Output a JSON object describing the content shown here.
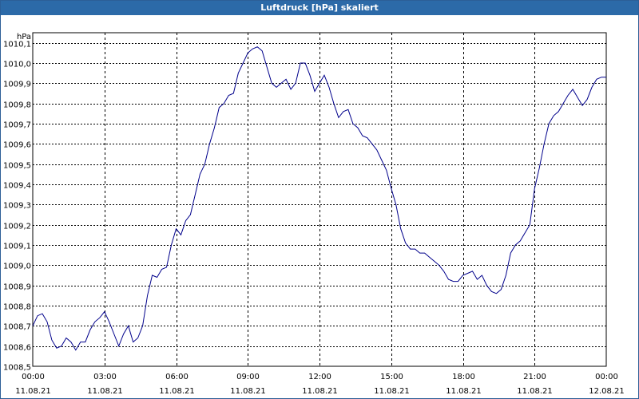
{
  "window": {
    "title": "Luftdruck [hPa] skaliert"
  },
  "colors": {
    "title_bar": "#2c6aa8",
    "series_line": "#00008b",
    "grid": "#000000"
  },
  "chart_data": {
    "type": "line",
    "title": "Luftdruck [hPa] skaliert",
    "ylabel": "hPa",
    "xlabel": "",
    "ylim": [
      1008.5,
      1010.15
    ],
    "yticks": [
      "1008,5",
      "1008,6",
      "1008,7",
      "1008,8",
      "1008,9",
      "1009,0",
      "1009,1",
      "1009,2",
      "1009,3",
      "1009,4",
      "1009,5",
      "1009,6",
      "1009,7",
      "1009,8",
      "1009,9",
      "1010,0",
      "1010,1"
    ],
    "xticks": [
      {
        "time": "00:00",
        "date": "11.08.21"
      },
      {
        "time": "03:00",
        "date": "11.08.21"
      },
      {
        "time": "06:00",
        "date": "11.08.21"
      },
      {
        "time": "09:00",
        "date": "11.08.21"
      },
      {
        "time": "12:00",
        "date": "11.08.21"
      },
      {
        "time": "15:00",
        "date": "11.08.21"
      },
      {
        "time": "18:00",
        "date": "11.08.21"
      },
      {
        "time": "21:00",
        "date": "11.08.21"
      },
      {
        "time": "00:00",
        "date": "12.08.21"
      }
    ],
    "grid": true,
    "series": [
      {
        "x_hours": [
          0,
          0.2,
          0.4,
          0.6,
          0.8,
          1.0,
          1.2,
          1.4,
          1.6,
          1.8,
          2.0,
          2.2,
          2.4,
          2.6,
          2.8,
          3.0,
          3.2,
          3.4,
          3.6,
          3.8,
          4.0,
          4.2,
          4.4,
          4.6,
          4.8,
          5.0,
          5.2,
          5.4,
          5.6,
          5.8,
          6.0,
          6.2,
          6.4,
          6.6,
          6.8,
          7.0,
          7.2,
          7.4,
          7.6,
          7.8,
          8.0,
          8.2,
          8.4,
          8.6,
          8.8,
          9.0,
          9.2,
          9.4,
          9.6,
          9.8,
          10.0,
          10.2,
          10.4,
          10.6,
          10.8,
          11.0,
          11.2,
          11.4,
          11.6,
          11.8,
          12.0,
          12.2,
          12.4,
          12.6,
          12.8,
          13.0,
          13.2,
          13.4,
          13.6,
          13.8,
          14.0,
          14.2,
          14.4,
          14.6,
          14.8,
          15.0,
          15.2,
          15.4,
          15.6,
          15.8,
          16.0,
          16.2,
          16.4,
          16.6,
          16.8,
          17.0,
          17.2,
          17.4,
          17.6,
          17.8,
          18.0,
          18.2,
          18.4,
          18.6,
          18.8,
          19.0,
          19.2,
          19.4,
          19.6,
          19.8,
          20.0,
          20.2,
          20.4,
          20.6,
          20.8,
          21.0,
          21.2,
          21.4,
          21.6,
          21.8,
          22.0,
          22.2,
          22.4,
          22.6,
          22.8,
          23.0,
          23.2,
          23.4,
          23.6,
          23.8,
          24.0
        ],
        "y_hpa": [
          1008.7,
          1008.75,
          1008.76,
          1008.72,
          1008.63,
          1008.59,
          1008.6,
          1008.64,
          1008.62,
          1008.58,
          1008.62,
          1008.62,
          1008.68,
          1008.72,
          1008.74,
          1008.77,
          1008.72,
          1008.66,
          1008.6,
          1008.66,
          1008.7,
          1008.62,
          1008.64,
          1008.7,
          1008.85,
          1008.95,
          1008.94,
          1008.98,
          1008.99,
          1009.1,
          1009.18,
          1009.15,
          1009.22,
          1009.25,
          1009.35,
          1009.45,
          1009.5,
          1009.6,
          1009.68,
          1009.78,
          1009.8,
          1009.84,
          1009.85,
          1009.95,
          1010.0,
          1010.05,
          1010.07,
          1010.08,
          1010.06,
          1009.98,
          1009.9,
          1009.88,
          1009.9,
          1009.92,
          1009.87,
          1009.9,
          1010.0,
          1010.0,
          1009.94,
          1009.86,
          1009.9,
          1009.94,
          1009.88,
          1009.8,
          1009.73,
          1009.76,
          1009.77,
          1009.7,
          1009.68,
          1009.64,
          1009.63,
          1009.6,
          1009.57,
          1009.52,
          1009.47,
          1009.38,
          1009.3,
          1009.18,
          1009.11,
          1009.08,
          1009.08,
          1009.06,
          1009.06,
          1009.04,
          1009.02,
          1009.0,
          1008.97,
          1008.93,
          1008.92,
          1008.92,
          1008.95,
          1008.96,
          1008.97,
          1008.93,
          1008.95,
          1008.9,
          1008.87,
          1008.86,
          1008.88,
          1008.95,
          1009.06,
          1009.1,
          1009.12,
          1009.16,
          1009.2,
          1009.38,
          1009.48,
          1009.6,
          1009.7,
          1009.74,
          1009.76,
          1009.8,
          1009.84,
          1009.87,
          1009.83,
          1009.79,
          1009.82,
          1009.88,
          1009.92,
          1009.93,
          1009.93,
          1009.9,
          1009.87
        ]
      }
    ]
  }
}
